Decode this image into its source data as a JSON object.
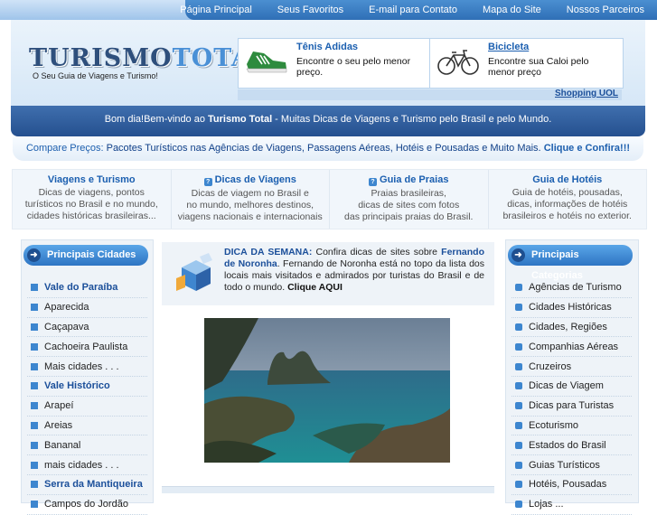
{
  "nav": {
    "items": [
      "Página Principal",
      "Seus Favoritos",
      "E-mail para Contato",
      "Mapa do Site",
      "Nossos Parceiros"
    ]
  },
  "brand": {
    "logo_part1": "TURISMO",
    "logo_part2": "TOTAL",
    "tagline": "O Seu Guia de Viagens e Turismo!"
  },
  "ads": [
    {
      "title": "Tênis Adidas",
      "desc": "Encontre o seu pelo menor preço.",
      "icon": "sneaker-icon"
    },
    {
      "title": "Bicicleta",
      "desc": "Encontre sua Caloi pelo menor preço",
      "icon": "bicycle-icon"
    }
  ],
  "ads_source": "Shopping UOL",
  "greeting": {
    "pre": "Bom dia!Bem-vindo ao ",
    "brand": "Turismo Total",
    "post": " - Muitas Dicas de Viagens e Turismo pelo Brasil e pelo Mundo."
  },
  "compare": {
    "lead": "Compare Preços:",
    "text": " Pacotes Turísticos nas Agências de Viagens, Passagens Aéreas, Hotéis e Pousadas e Muito Mais. ",
    "cta": "Clique e Confira!!!"
  },
  "features": [
    {
      "title": "Viagens e Turismo",
      "icon": "",
      "lines": [
        "Dicas de viagens, pontos",
        "turísticos no Brasil e no mundo,",
        "cidades históricas brasileiras..."
      ]
    },
    {
      "title": "Dicas de Viagens",
      "icon": "tip-icon",
      "lines": [
        "Dicas de viagem no Brasil e",
        "no mundo, melhores destinos,",
        "viagens nacionais e internacionais"
      ]
    },
    {
      "title": "Guia de Praias",
      "icon": "tip-icon",
      "lines": [
        "Praias brasileiras,",
        "dicas de sites com fotos",
        "das principais praias do Brasil."
      ]
    },
    {
      "title": "Guia de Hotéis",
      "icon": "",
      "lines": [
        "Guia de hotéis, pousadas,",
        "dicas, informações de hotéis",
        "brasileiros e hotéis no exterior."
      ]
    }
  ],
  "left_sidebar": {
    "title": "Principais Cidades",
    "items": [
      {
        "label": "Vale do Paraíba",
        "section": true
      },
      {
        "label": "Aparecida",
        "section": false
      },
      {
        "label": "Caçapava",
        "section": false
      },
      {
        "label": "Cachoeira Paulista",
        "section": false
      },
      {
        "label": "Mais cidades . . .",
        "section": false
      },
      {
        "label": "Vale Histórico",
        "section": true
      },
      {
        "label": "Arapeí",
        "section": false
      },
      {
        "label": "Areias",
        "section": false
      },
      {
        "label": "Bananal",
        "section": false
      },
      {
        "label": "mais cidades . . .",
        "section": false
      },
      {
        "label": "Serra da Mantiqueira",
        "section": true
      },
      {
        "label": "Campos do Jordão",
        "section": false
      }
    ]
  },
  "right_sidebar": {
    "title": "Principais Categorias",
    "items": [
      "Agências de Turismo",
      "Cidades Históricas",
      "Cidades, Regiões",
      "Companhias Aéreas",
      "Cruzeiros",
      "Dicas de Viagem",
      "Dicas para Turistas",
      "Ecoturismo",
      "Estados do Brasil",
      "Guias Turísticos",
      "Hotéis, Pousadas",
      "Lojas ..."
    ]
  },
  "dica": {
    "label": "DICA DA SEMANA:",
    "text1": " Confira dicas de sites sobre ",
    "place": "Fernando de Noronha",
    "text2": ". Fernando de Noronha está no topo da lista dos locais mais visitados e admirados por turistas do Brasil e de todo o mundo. ",
    "cta": "Clique AQUI"
  },
  "colors": {
    "accent": "#2f6fb6",
    "link": "#1b5fb0",
    "header_bg": "#d6e7f7"
  }
}
